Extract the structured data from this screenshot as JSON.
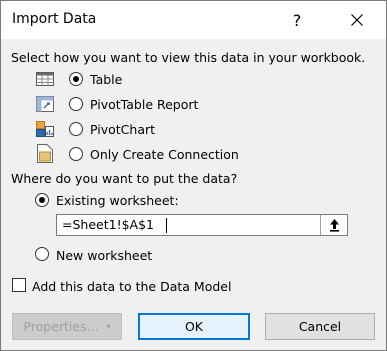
{
  "window": {
    "title": "Import Data",
    "help_label": "?"
  },
  "view_section": {
    "prompt": "Select how you want to view this data in your workbook.",
    "options": [
      {
        "label": "Table",
        "selected": true,
        "icon": "table-icon"
      },
      {
        "label": "PivotTable Report",
        "selected": false,
        "icon": "pivottable-icon"
      },
      {
        "label": "PivotChart",
        "selected": false,
        "icon": "pivotchart-icon"
      },
      {
        "label": "Only Create Connection",
        "selected": false,
        "icon": "connection-icon"
      }
    ]
  },
  "location_section": {
    "prompt": "Where do you want to put the data?",
    "existing_label": "Existing worksheet:",
    "existing_selected": true,
    "existing_value": "=Sheet1!$A$1",
    "new_label": "New worksheet",
    "new_selected": false
  },
  "data_model": {
    "label": "Add this data to the Data Model",
    "checked": false
  },
  "buttons": {
    "properties": "Properties...",
    "ok": "OK",
    "cancel": "Cancel"
  },
  "colors": {
    "accent": "#0078d7",
    "dialog_bg": "#f0f0f0",
    "titlebar_bg": "#ffffff"
  }
}
